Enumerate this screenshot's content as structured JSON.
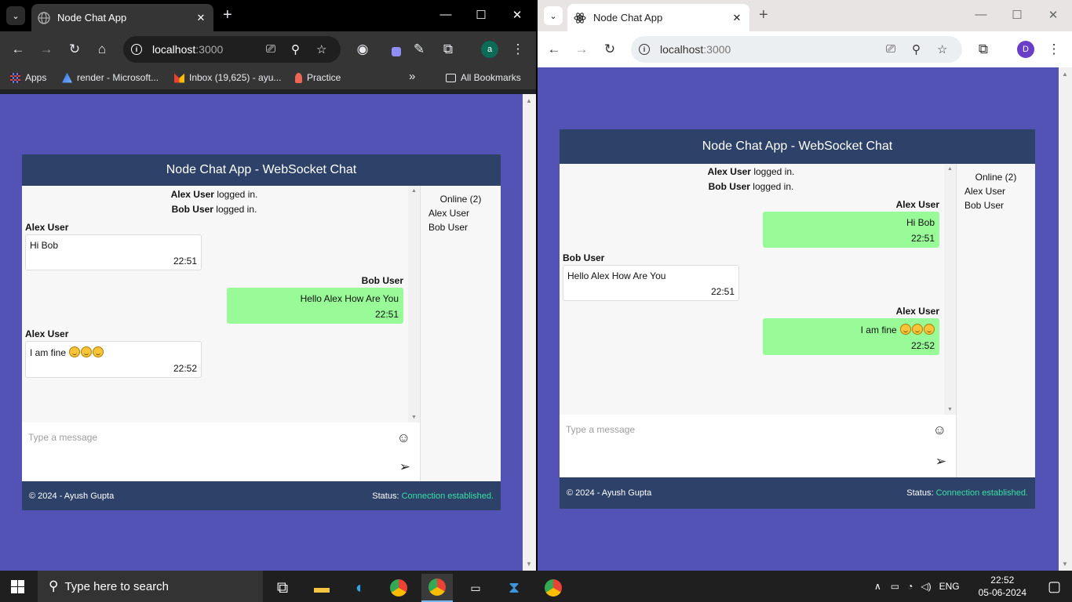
{
  "left_window": {
    "tab_title": "Node Chat App",
    "url_host": "localhost",
    "url_port": ":3000",
    "profile_initial": "a",
    "bookmarks": [
      "Apps",
      "render - Microsoft...",
      "Inbox (19,625) - ayu...",
      "Practice"
    ],
    "all_bookmarks": "All Bookmarks",
    "chevron": "»"
  },
  "right_window": {
    "tab_title": "Node Chat App",
    "url_host": "localhost",
    "url_port": ":3000",
    "profile_initial": "D"
  },
  "chat_left": {
    "header": "Node Chat App - WebSocket Chat",
    "system": [
      {
        "user": "Alex User",
        "text": " logged in."
      },
      {
        "user": "Bob User",
        "text": " logged in."
      }
    ],
    "messages": [
      {
        "sender": "Alex User",
        "text": "Hi Bob",
        "emoji_count": 0,
        "time": "22:51",
        "mine": false
      },
      {
        "sender": "Bob User",
        "text": "Hello Alex How Are You",
        "emoji_count": 0,
        "time": "22:51",
        "mine": true
      },
      {
        "sender": "Alex User",
        "text": "I am fine ",
        "emoji_count": 3,
        "time": "22:52",
        "mine": false
      }
    ],
    "online_title": "Online (2)",
    "online_users": [
      "Alex User",
      "Bob User"
    ],
    "placeholder": "Type a message",
    "footer_copy": "© 2024 - Ayush Gupta",
    "status_label": "Status: ",
    "status_value": "Connection established."
  },
  "chat_right": {
    "header": "Node Chat App - WebSocket Chat",
    "system": [
      {
        "user": "Alex User",
        "text": " logged in."
      },
      {
        "user": "Bob User",
        "text": " logged in."
      }
    ],
    "messages": [
      {
        "sender": "Alex User",
        "text": "Hi Bob",
        "emoji_count": 0,
        "time": "22:51",
        "mine": true
      },
      {
        "sender": "Bob User",
        "text": "Hello Alex How Are You",
        "emoji_count": 0,
        "time": "22:51",
        "mine": false
      },
      {
        "sender": "Alex User",
        "text": "I am fine ",
        "emoji_count": 3,
        "time": "22:52",
        "mine": true
      }
    ],
    "online_title": "Online (2)",
    "online_users": [
      "Alex User",
      "Bob User"
    ],
    "placeholder": "Type a message",
    "footer_copy": "© 2024 - Ayush Gupta",
    "status_label": "Status: ",
    "status_value": "Connection established."
  },
  "taskbar": {
    "search_placeholder": "Type here to search",
    "language": "ENG",
    "time": "22:52",
    "date": "05-06-2024"
  },
  "colors": {
    "page_bg": "#5353b5",
    "chat_header": "#2e4269",
    "own_bubble": "#98fb98",
    "status_ok": "#37e0a3"
  }
}
